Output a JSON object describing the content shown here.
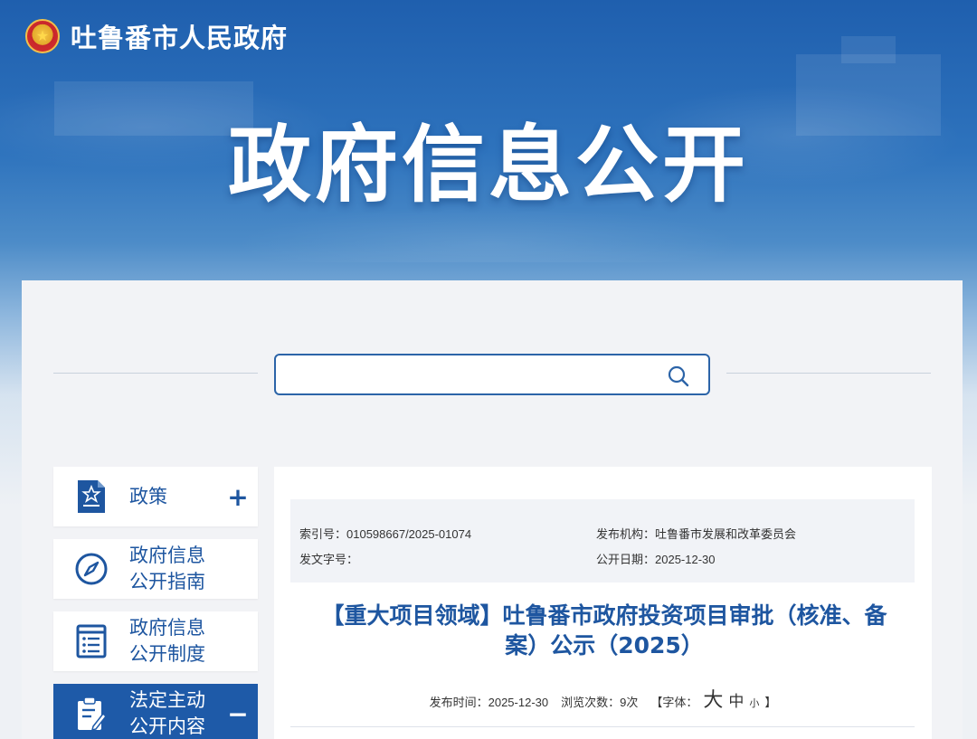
{
  "header": {
    "site_name": "吐鲁番市人民政府",
    "banner_title": "政府信息公开"
  },
  "search": {
    "placeholder": "",
    "value": ""
  },
  "sidebar": {
    "items": [
      {
        "line1": "政策",
        "line2": "",
        "toggle": "+",
        "icon": "document-star-icon",
        "active": false
      },
      {
        "line1": "政府信息",
        "line2": "公开指南",
        "toggle": "",
        "icon": "compass-icon",
        "active": false
      },
      {
        "line1": "政府信息",
        "line2": "公开制度",
        "toggle": "",
        "icon": "list-document-icon",
        "active": false
      },
      {
        "line1": "法定主动",
        "line2": "公开内容",
        "toggle": "−",
        "icon": "clipboard-edit-icon",
        "active": true
      }
    ]
  },
  "article": {
    "meta": {
      "index_no": "索引号：010598667/2025-01074",
      "issuer": "发布机构：吐鲁番市发展和改革委员会",
      "doc_no": "发文字号：",
      "open_date": "公开日期：2025-12-30"
    },
    "title_line1": "【重大项目领域】吐鲁番市政府投资项目审批（核准、备",
    "title_line2": "案）公示（2025）",
    "publish_time": "发布时间：2025-12-30",
    "view_count": "浏览次数：9次",
    "font_label": "【字体：",
    "font_big": "大",
    "font_mid": "中",
    "font_small": "小",
    "font_close": "】"
  },
  "colors": {
    "primary_blue": "#1e56a0",
    "active_bg": "#1e5aa8",
    "search_border": "#2c64a8"
  }
}
